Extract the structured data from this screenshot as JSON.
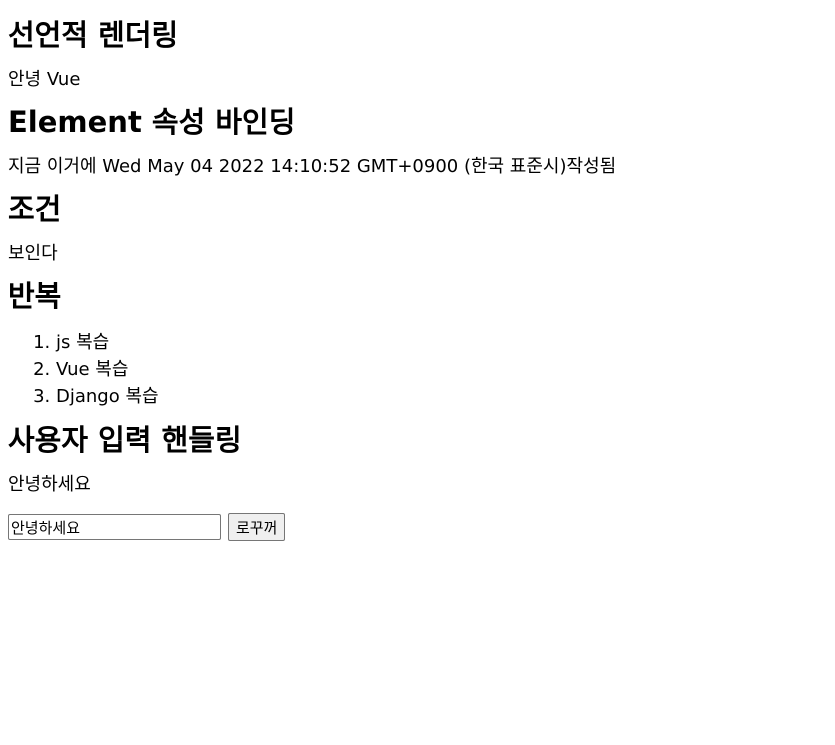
{
  "sections": {
    "declarative": {
      "heading": "선언적 렌더링",
      "text": "안녕 Vue"
    },
    "binding": {
      "heading": "Element 속성 바인딩",
      "text": "지금 이거에 Wed May 04 2022 14:10:52 GMT+0900 (한국 표준시)작성됨"
    },
    "condition": {
      "heading": "조건",
      "text": "보인다"
    },
    "loop": {
      "heading": "반복",
      "items": [
        "js 복습",
        "Vue 복습",
        "Django 복습"
      ]
    },
    "input": {
      "heading": "사용자 입력 핸들링",
      "text": "안녕하세요",
      "field_value": "안녕하세요",
      "button_label": "로꾸꺼"
    }
  }
}
